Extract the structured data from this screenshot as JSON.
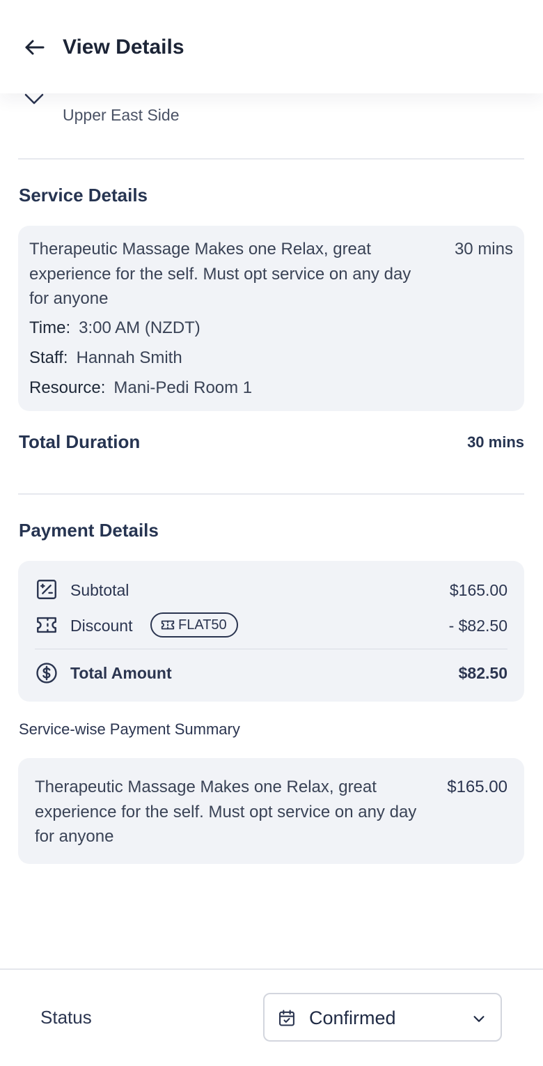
{
  "header": {
    "title": "View Details"
  },
  "location": {
    "area": "Upper East Side"
  },
  "service_details": {
    "section_title": "Service Details",
    "items": [
      {
        "description": "Therapeutic Massage Makes one Relax, great experience for the self. Must opt service on any day for anyone",
        "duration": "30 mins",
        "time_label": "Time:",
        "time_value": "3:00 AM (NZDT)",
        "staff_label": "Staff:",
        "staff_value": "Hannah Smith",
        "resource_label": "Resource:",
        "resource_value": "Mani-Pedi Room 1"
      }
    ],
    "total_duration_label": "Total Duration",
    "total_duration_value": "30 mins"
  },
  "payment_details": {
    "section_title": "Payment Details",
    "subtotal_label": "Subtotal",
    "subtotal_value": "$165.00",
    "discount_label": "Discount",
    "coupon_code": "FLAT50",
    "discount_value": "- $82.50",
    "total_label": "Total Amount",
    "total_value": "$82.50"
  },
  "summary": {
    "label": "Service-wise Payment Summary",
    "items": [
      {
        "description": "Therapeutic Massage Makes one Relax, great experience for the self. Must opt service on any day for anyone",
        "price": "$165.00"
      }
    ]
  },
  "footer": {
    "status_label": "Status",
    "status_value": "Confirmed"
  },
  "icons": {
    "back": "arrow-left-icon",
    "location_toggle": "chevron-down-icon",
    "subtotal": "percent-square-icon",
    "discount": "ticket-icon",
    "coupon": "ticket-icon",
    "total": "dollar-circle-icon",
    "status": "calendar-check-icon",
    "status_dropdown": "chevron-down-icon"
  },
  "colors": {
    "text_primary": "#1f2a44",
    "card_background": "#f1f3f7",
    "divider": "#e6e8ee"
  }
}
